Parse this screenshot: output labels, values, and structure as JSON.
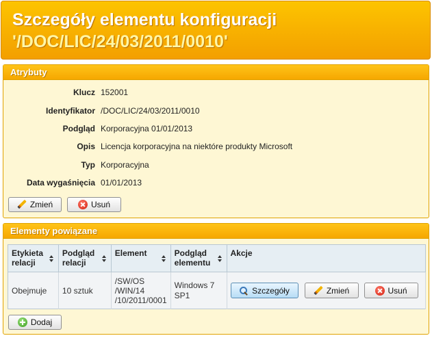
{
  "header": {
    "title_line1": "Szczegóły elementu konfiguracji",
    "title_line2": "'/DOC/LIC/24/03/2011/0010'"
  },
  "attributes": {
    "title": "Atrybuty",
    "rows": [
      {
        "label": "Klucz",
        "value": "152001"
      },
      {
        "label": "Identyfikator",
        "value": "/DOC/LIC/24/03/2011/0010"
      },
      {
        "label": "Podgląd",
        "value": "Korporacyjna 01/01/2013"
      },
      {
        "label": "Opis",
        "value": "Licencja korporacyjna na niektóre produkty Microsoft"
      },
      {
        "label": "Typ",
        "value": "Korporacyjna"
      },
      {
        "label": "Data wygaśnięcia",
        "value": "01/01/2013"
      }
    ],
    "edit_label": "Zmień",
    "delete_label": "Usuń"
  },
  "related": {
    "title": "Elementy powiązane",
    "columns": [
      "Etykieta relacji",
      "Podgląd relacji",
      "Element",
      "Podgląd elementu",
      "Akcje"
    ],
    "rows": [
      {
        "relation_label": "Obejmuje",
        "relation_preview": "10 sztuk",
        "element": "/SW/OS /WIN/14 /10/2011/0001",
        "element_preview": "Windows 7 SP1",
        "details_label": "Szczegóły",
        "edit_label": "Zmień",
        "delete_label": "Usuń"
      }
    ],
    "add_label": "Dodaj"
  },
  "icons": [
    "pencil-icon",
    "delete-icon",
    "search-icon",
    "add-icon",
    "sort-icon"
  ],
  "colors": {
    "header_top": "#fdc400",
    "header_bottom": "#f39f00",
    "panel_bg": "#fef7d4",
    "table_header": "#e6eef3"
  }
}
